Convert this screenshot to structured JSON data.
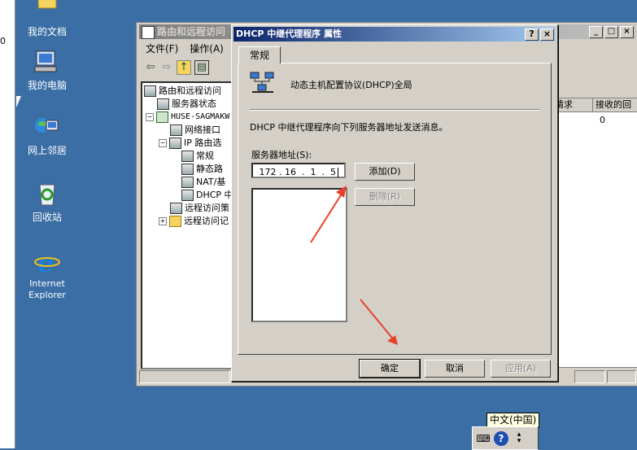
{
  "desktop": {
    "edge_text": "0",
    "icons": [
      {
        "label": "我的文档",
        "icon": "my-documents-icon"
      },
      {
        "label": "我的电脑",
        "icon": "my-computer-icon"
      },
      {
        "label": "网上邻居",
        "icon": "network-places-icon"
      },
      {
        "label": "回收站",
        "icon": "recycle-bin-icon"
      },
      {
        "label": "Internet Explorer",
        "icon": "internet-explorer-icon"
      }
    ]
  },
  "bg_window": {
    "title": "路由和远程访问",
    "menu": [
      "文件(F)",
      "操作(A)"
    ],
    "tree": [
      {
        "label": "路由和远程访问"
      },
      {
        "label": "服务器状态"
      },
      {
        "label": "HUSE-SAGMAKW"
      },
      {
        "label": "网络接口"
      },
      {
        "label": "IP 路由选"
      },
      {
        "label": "常规"
      },
      {
        "label": "静态路"
      },
      {
        "label": "NAT/基"
      },
      {
        "label": "DHCP 中"
      },
      {
        "label": "远程访问策"
      },
      {
        "label": "远程访问记"
      }
    ],
    "list_headers": [
      "请求",
      "接收的回"
    ],
    "list_value": "0"
  },
  "dialog": {
    "title": "DHCP 中继代理程序 属性",
    "help_button": "?",
    "close_button": "×",
    "tab": "常规",
    "header_text": "动态主机配置协议(DHCP)全局",
    "description": "DHCP 中继代理程序向下列服务器地址发送消息。",
    "server_label": "服务器地址(S):",
    "ip_value": " 172 . 16  .  1  .  5",
    "add_button": "添加(D)",
    "delete_button": "删除(R)",
    "ok_button": "确定",
    "cancel_button": "取消",
    "apply_button": "应用(A)"
  },
  "taskbar": {
    "language_tooltip": "中文(中国)",
    "tray_icons": [
      "keyboard-icon",
      "help-icon",
      "options-icon"
    ]
  },
  "colors": {
    "desktop": "#3a6ea5",
    "dialog_title_start": "#0a246a",
    "dialog_title_end": "#a6caf0",
    "annotation_arrow": "#e8402a"
  }
}
